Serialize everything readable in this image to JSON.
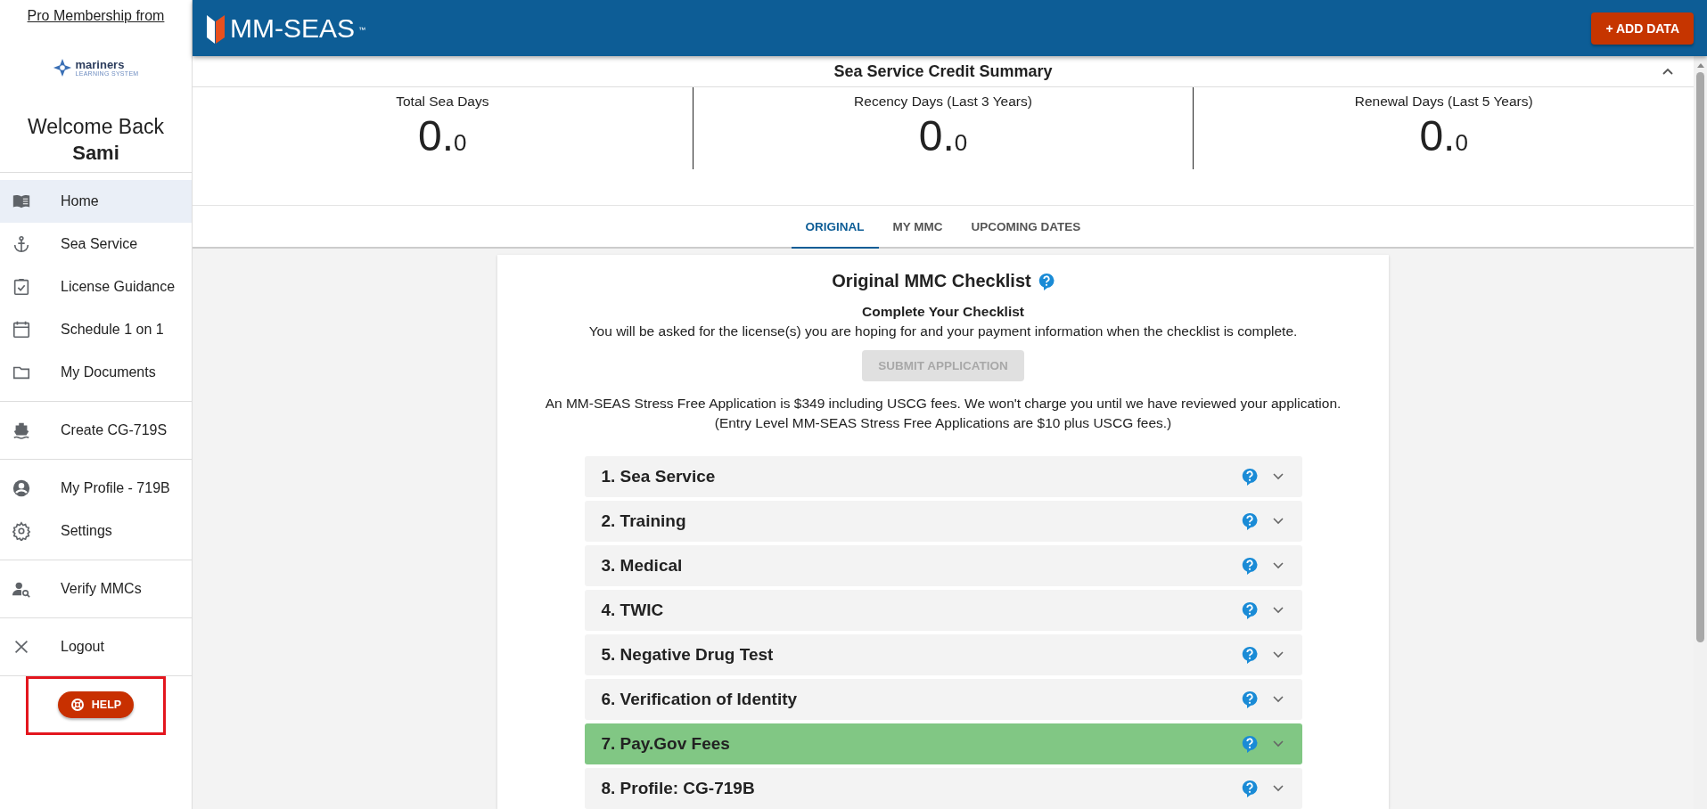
{
  "sidebar": {
    "promo_link": "Pro Membership from",
    "logo": {
      "name": "mariners",
      "tagline": "LEARNING SYSTEM"
    },
    "welcome": "Welcome Back",
    "user_name": "Sami",
    "groups": [
      {
        "items": [
          {
            "label": "Home",
            "selected": true
          },
          {
            "label": "Sea Service",
            "selected": false
          },
          {
            "label": "License Guidance",
            "selected": false
          },
          {
            "label": "Schedule 1 on 1",
            "selected": false
          },
          {
            "label": "My Documents",
            "selected": false
          }
        ]
      },
      {
        "items": [
          {
            "label": "Create CG-719S",
            "selected": false
          }
        ]
      },
      {
        "items": [
          {
            "label": "My Profile - 719B",
            "selected": false
          },
          {
            "label": "Settings",
            "selected": false
          }
        ]
      },
      {
        "items": [
          {
            "label": "Verify MMCs",
            "selected": false
          }
        ]
      },
      {
        "items": [
          {
            "label": "Logout",
            "selected": false
          }
        ]
      }
    ],
    "help_button": "HELP",
    "help_highlighted": true
  },
  "header": {
    "brand": "MM-SEAS",
    "trademark": "™",
    "add_button": "+ ADD DATA"
  },
  "summary": {
    "title": "Sea Service Credit Summary",
    "expanded": true,
    "stats": [
      {
        "label": "Total Sea Days",
        "whole": "0.",
        "fraction": "0"
      },
      {
        "label": "Recency Days (Last 3 Years)",
        "whole": "0.",
        "fraction": "0"
      },
      {
        "label": "Renewal Days (Last 5 Years)",
        "whole": "0.",
        "fraction": "0"
      }
    ]
  },
  "tabs": [
    {
      "label": "ORIGINAL",
      "selected": true
    },
    {
      "label": "MY MMC",
      "selected": false
    },
    {
      "label": "UPCOMING DATES",
      "selected": false
    }
  ],
  "checklist": {
    "title": "Original MMC Checklist",
    "subtitle": "Complete Your Checklist",
    "intro": "You will be asked for the license(s) you are hoping for and your payment information when the checklist is complete.",
    "submit_button": "SUBMIT APPLICATION",
    "submit_disabled": true,
    "price_note": "An MM-SEAS Stress Free Application is $349 including USCG fees. We won't charge you until we have reviewed your application.",
    "entry_note": "(Entry Level MM-SEAS Stress Free Applications are $10 plus USCG fees.)",
    "items": [
      {
        "label": "1. Sea Service",
        "completed": false
      },
      {
        "label": "2. Training",
        "completed": false
      },
      {
        "label": "3. Medical",
        "completed": false
      },
      {
        "label": "4. TWIC",
        "completed": false
      },
      {
        "label": "5. Negative Drug Test",
        "completed": false
      },
      {
        "label": "6. Verification of Identity",
        "completed": false
      },
      {
        "label": "7. Pay.Gov Fees",
        "completed": true
      },
      {
        "label": "8. Profile: CG-719B",
        "completed": false
      }
    ]
  }
}
